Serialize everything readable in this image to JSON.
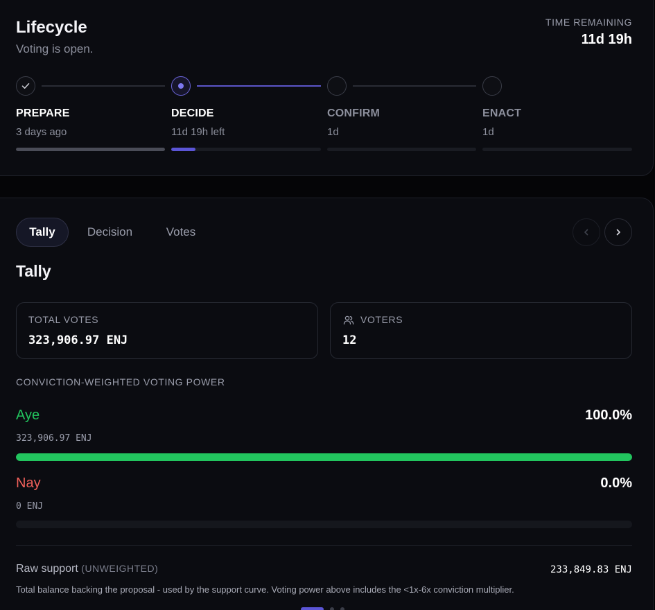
{
  "lifecycle": {
    "title": "Lifecycle",
    "status": "Voting is open.",
    "time_remaining_label": "TIME REMAINING",
    "time_remaining_value": "11d 19h",
    "steps": [
      {
        "name": "PREPARE",
        "sub": "3 days ago",
        "state": "done",
        "progress": 1.0,
        "color": "#4a4c57"
      },
      {
        "name": "DECIDE",
        "sub": "11d 19h left",
        "state": "active",
        "progress": 0.16,
        "color": "#5b55d6"
      },
      {
        "name": "CONFIRM",
        "sub": "1d",
        "state": "pending",
        "progress": 0,
        "color": "#2a2c35"
      },
      {
        "name": "ENACT",
        "sub": "1d",
        "state": "pending",
        "progress": 0,
        "color": "#2a2c35"
      }
    ]
  },
  "tabs": [
    {
      "label": "Tally",
      "active": true
    },
    {
      "label": "Decision",
      "active": false
    },
    {
      "label": "Votes",
      "active": false
    }
  ],
  "nav": {
    "prev_icon": "chevron-left-icon",
    "next_icon": "chevron-right-icon",
    "prev_disabled": true
  },
  "tally": {
    "heading": "Tally",
    "total_votes_label": "TOTAL VOTES",
    "total_votes_value": "323,906.97 ENJ",
    "voters_label": "VOTERS",
    "voters_value": "12",
    "voters_icon": "users-icon",
    "section_label": "CONVICTION-WEIGHTED VOTING POWER",
    "aye": {
      "label": "Aye",
      "percent": "100.0%",
      "amount": "323,906.97 ENJ",
      "fraction": 1.0,
      "color": "#22c55e"
    },
    "nay": {
      "label": "Nay",
      "percent": "0.0%",
      "amount": "0 ENJ",
      "fraction": 0.0,
      "color": "#f0605a"
    },
    "raw_support_label": "Raw support",
    "raw_support_paren": "(UNWEIGHTED)",
    "raw_support_value": "233,849.83 ENJ",
    "note": "Total balance backing the proposal - used by the support curve. Voting power above includes the <1x-6x conviction multiplier."
  },
  "colors": {
    "accent": "#5b55d6",
    "aye": "#22c55e",
    "nay": "#f0605a"
  }
}
